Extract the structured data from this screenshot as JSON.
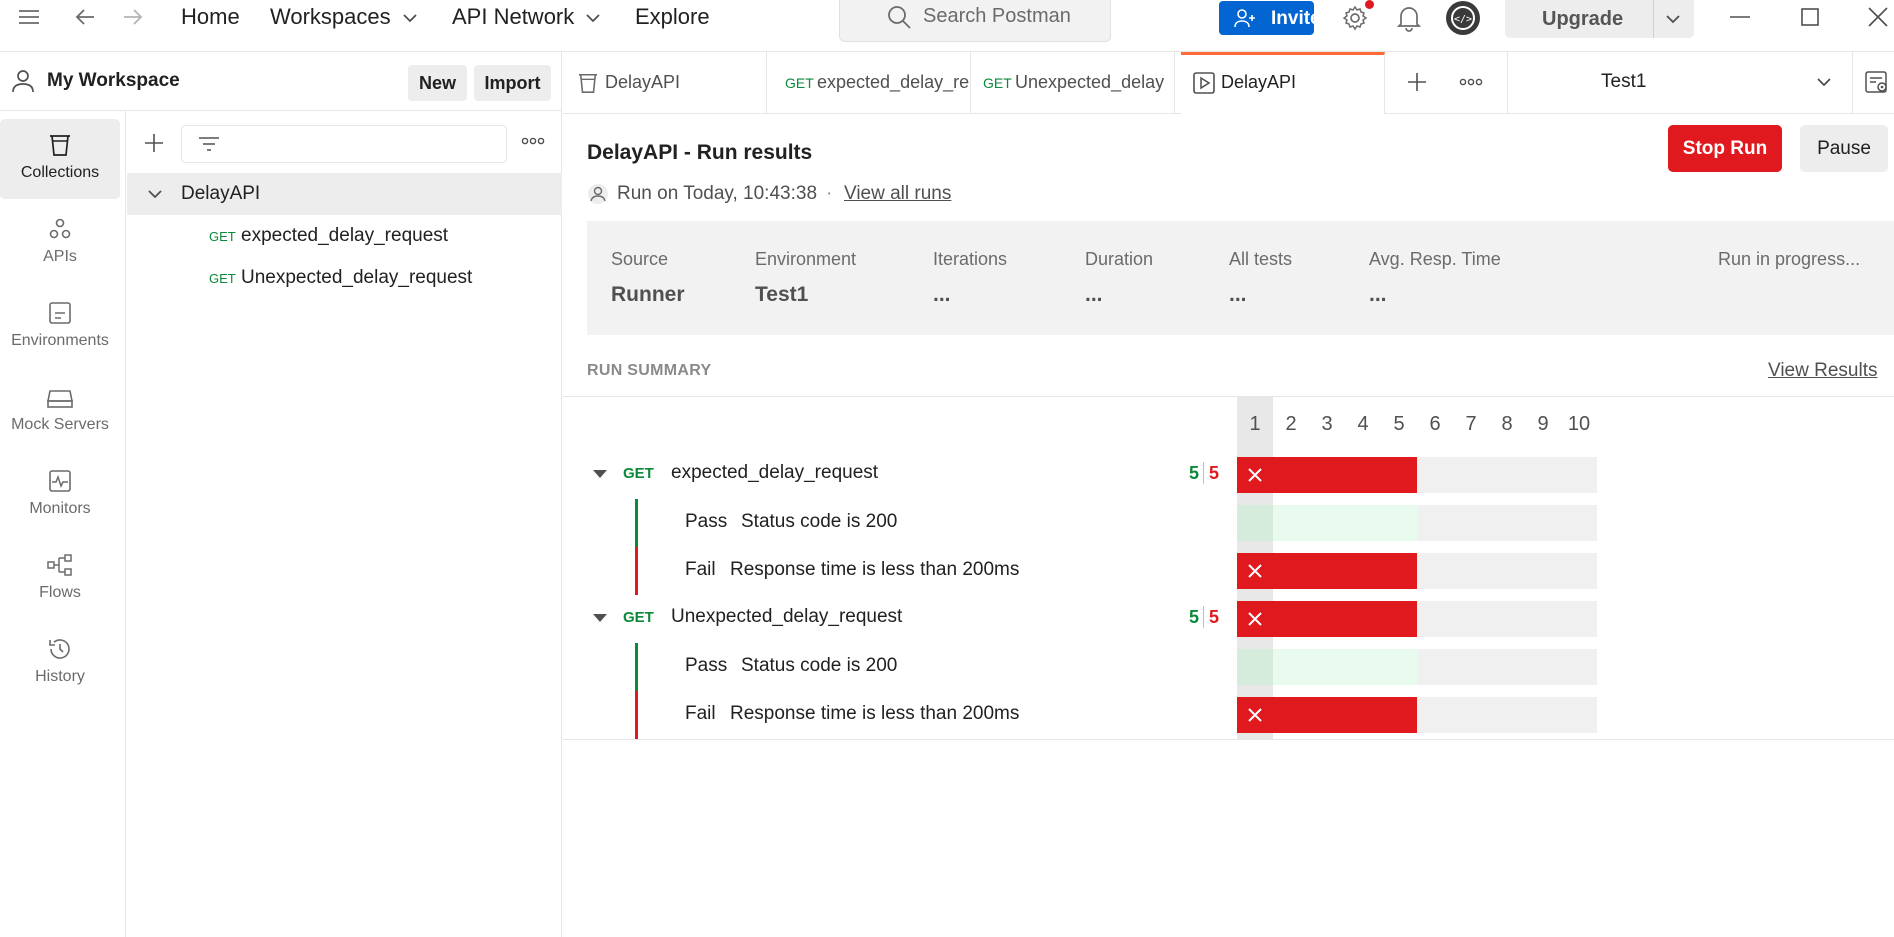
{
  "topbar": {
    "home": "Home",
    "workspaces": "Workspaces",
    "api_network": "API Network",
    "explore": "Explore",
    "search_placeholder": "Search Postman",
    "invite": "Invite",
    "upgrade": "Upgrade"
  },
  "workspace": {
    "title": "My Workspace",
    "new_label": "New",
    "import_label": "Import"
  },
  "rail": {
    "items": [
      {
        "label": "Collections",
        "icon": "collections-icon"
      },
      {
        "label": "APIs",
        "icon": "apis-icon"
      },
      {
        "label": "Environments",
        "icon": "environments-icon"
      },
      {
        "label": "Mock Servers",
        "icon": "mock-servers-icon"
      },
      {
        "label": "Monitors",
        "icon": "monitors-icon"
      },
      {
        "label": "Flows",
        "icon": "flows-icon"
      },
      {
        "label": "History",
        "icon": "history-icon"
      }
    ]
  },
  "tree": {
    "collection": "DelayAPI",
    "requests": [
      {
        "method": "GET",
        "name": "expected_delay_request"
      },
      {
        "method": "GET",
        "name": "Unexpected_delay_request"
      }
    ]
  },
  "tabs": {
    "items": [
      {
        "label": "DelayAPI",
        "method": ""
      },
      {
        "label": "expected_delay_re",
        "method": "GET"
      },
      {
        "label": "Unexpected_delay",
        "method": "GET"
      },
      {
        "label": "DelayAPI",
        "method": ""
      }
    ],
    "environment": "Test1"
  },
  "run": {
    "title": "DelayAPI - Run results",
    "run_on": "Run on Today, 10:43:38",
    "dot": "·",
    "view_all_runs": "View all runs",
    "stop_run": "Stop Run",
    "pause": "Pause",
    "stats": {
      "source_label": "Source",
      "source_value": "Runner",
      "environment_label": "Environment",
      "environment_value": "Test1",
      "iterations_label": "Iterations",
      "iterations_value": "...",
      "duration_label": "Duration",
      "duration_value": "...",
      "all_tests_label": "All tests",
      "all_tests_value": "...",
      "avg_label": "Avg. Resp. Time",
      "avg_value": "...",
      "status": "Run in progress..."
    },
    "summary_label": "RUN SUMMARY",
    "view_results": "View Results",
    "iterations": [
      "1",
      "2",
      "3",
      "4",
      "5",
      "6",
      "7",
      "8",
      "9",
      "10"
    ],
    "requests": [
      {
        "method": "GET",
        "name": "expected_delay_request",
        "pass_count": "5",
        "fail_count": "5",
        "tests": [
          {
            "status": "Pass",
            "name": "Status code is 200"
          },
          {
            "status": "Fail",
            "name": "Response time is less than 200ms"
          }
        ]
      },
      {
        "method": "GET",
        "name": "Unexpected_delay_request",
        "pass_count": "5",
        "fail_count": "5",
        "tests": [
          {
            "status": "Pass",
            "name": "Status code is 200"
          },
          {
            "status": "Fail",
            "name": "Response time is less than 200ms"
          }
        ]
      }
    ]
  },
  "colors": {
    "accent_orange": "#ff6c37",
    "invite_blue": "#0265d2",
    "fail_red": "#e0191f",
    "pass_green": "#0a8a3a"
  }
}
